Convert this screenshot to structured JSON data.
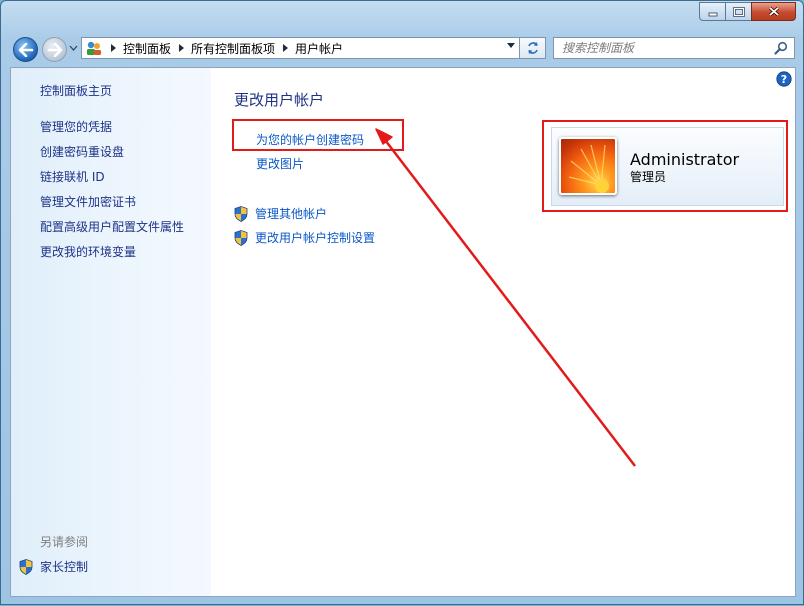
{
  "breadcrumb": [
    "控制面板",
    "所有控制面板项",
    "用户帐户"
  ],
  "search": {
    "placeholder": "搜索控制面板"
  },
  "sidebar": {
    "home_label": "控制面板主页",
    "items": [
      {
        "label": "管理您的凭据"
      },
      {
        "label": "创建密码重设盘"
      },
      {
        "label": "链接联机 ID"
      },
      {
        "label": "管理文件加密证书"
      },
      {
        "label": "配置高级用户配置文件属性"
      },
      {
        "label": "更改我的环境变量"
      }
    ],
    "see_also_heading": "另请参阅",
    "parental_controls_label": "家长控制"
  },
  "main": {
    "title": "更改用户帐户",
    "tasks": [
      {
        "label": "为您的帐户创建密码"
      },
      {
        "label": "更改图片"
      }
    ],
    "shield_tasks": [
      {
        "label": "管理其他帐户"
      },
      {
        "label": "更改用户帐户控制设置"
      }
    ]
  },
  "account": {
    "name": "Administrator",
    "role": "管理员"
  },
  "colors": {
    "link": "#0a58c8",
    "sidebar_link": "#1e3287",
    "annotation": "#e31a1a",
    "title": "#1e3287"
  },
  "icons": {
    "back": "back-arrow-icon",
    "forward": "forward-arrow-icon",
    "refresh": "refresh-icon",
    "search": "search-icon",
    "help": "help-icon",
    "shield": "uac-shield-icon",
    "location": "control-panel-icon"
  }
}
